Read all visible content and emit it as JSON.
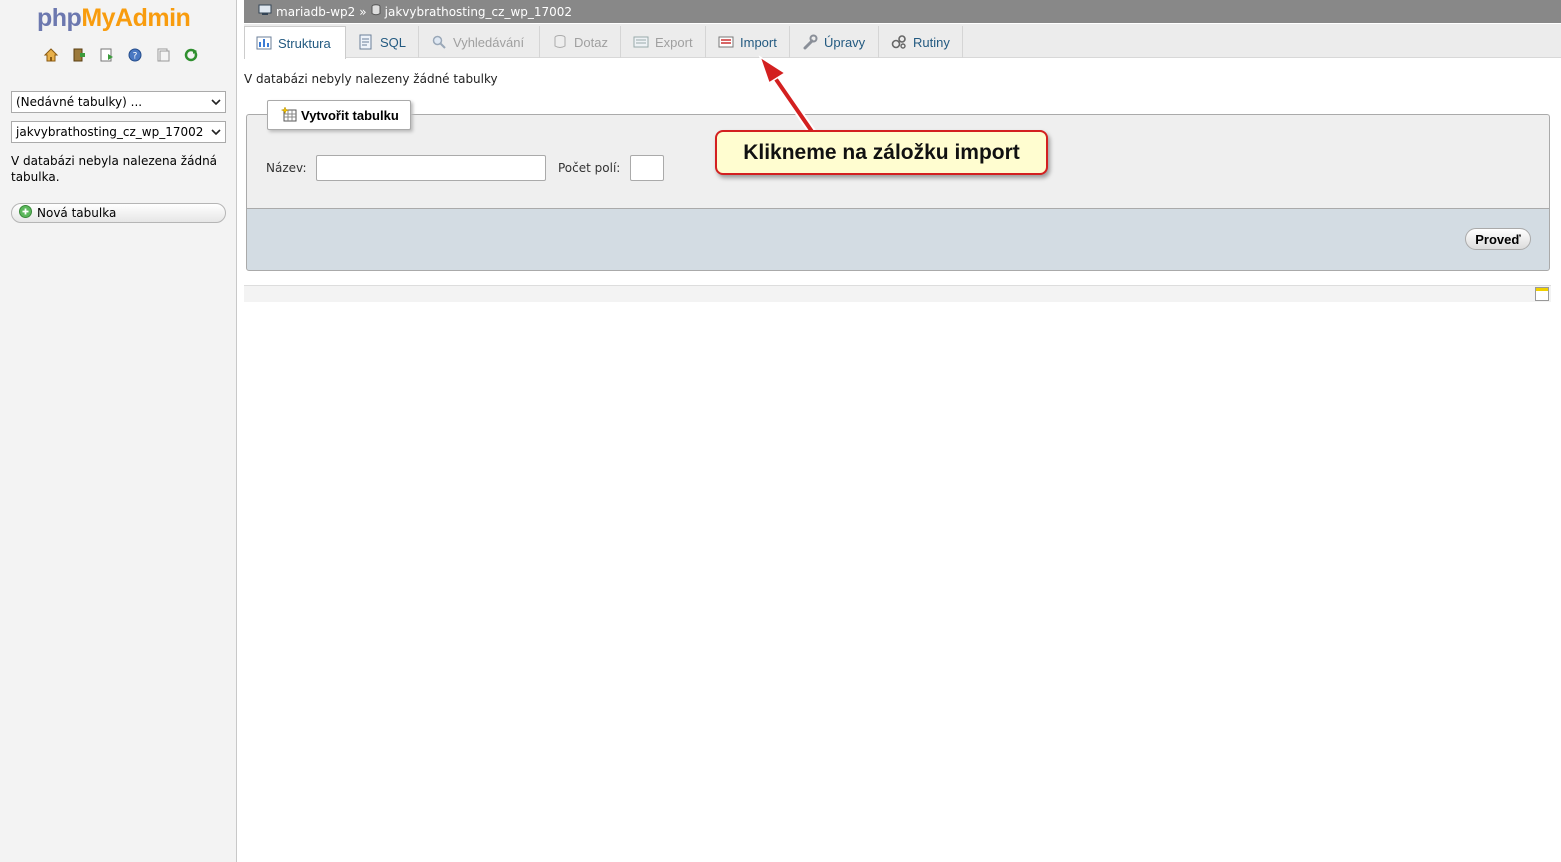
{
  "nav": {
    "logo_php": "php",
    "logo_myadmin": "MyAdmin",
    "icons": [
      "home-icon",
      "exit-icon",
      "query-window-icon",
      "docs-icon",
      "sql-docs-icon",
      "reload-icon"
    ],
    "recent_tables": "(Nedávné tabulky) ...",
    "database_select": "jakvybrathosting_cz_wp_17002",
    "empty_message": "V databázi nebyla nalezena žádná tabulka.",
    "new_table": "Nová tabulka"
  },
  "breadcrumb": {
    "server": "mariadb-wp2",
    "separator": "»",
    "database": "jakvybrathosting_cz_wp_17002"
  },
  "tabs": [
    {
      "label": "Struktura",
      "icon": "structure-icon",
      "state": "active"
    },
    {
      "label": "SQL",
      "icon": "sql-icon",
      "state": "enabled"
    },
    {
      "label": "Vyhledávání",
      "icon": "search-icon",
      "state": "disabled"
    },
    {
      "label": "Dotaz",
      "icon": "query-icon",
      "state": "disabled"
    },
    {
      "label": "Export",
      "icon": "export-icon",
      "state": "disabled"
    },
    {
      "label": "Import",
      "icon": "import-icon",
      "state": "enabled"
    },
    {
      "label": "Úpravy",
      "icon": "wrench-icon",
      "state": "enabled"
    },
    {
      "label": "Rutiny",
      "icon": "routines-icon",
      "state": "enabled"
    }
  ],
  "main": {
    "notice": "V databázi nebyly nalezeny žádné tabulky",
    "create_table_legend": "Vytvořit tabulku",
    "name_label": "Název:",
    "columns_label": "Počet polí:",
    "go_button": "Proveď"
  },
  "annotation": {
    "text": "Klikneme na záložku import",
    "border_color": "#d32020",
    "fill_color": "#fffdd0"
  },
  "colors": {
    "link": "#235a81",
    "logo_php": "#6c78af",
    "logo_myadmin": "#f89c0e",
    "serverbar": "#888888",
    "footer": "#d3dce3"
  }
}
